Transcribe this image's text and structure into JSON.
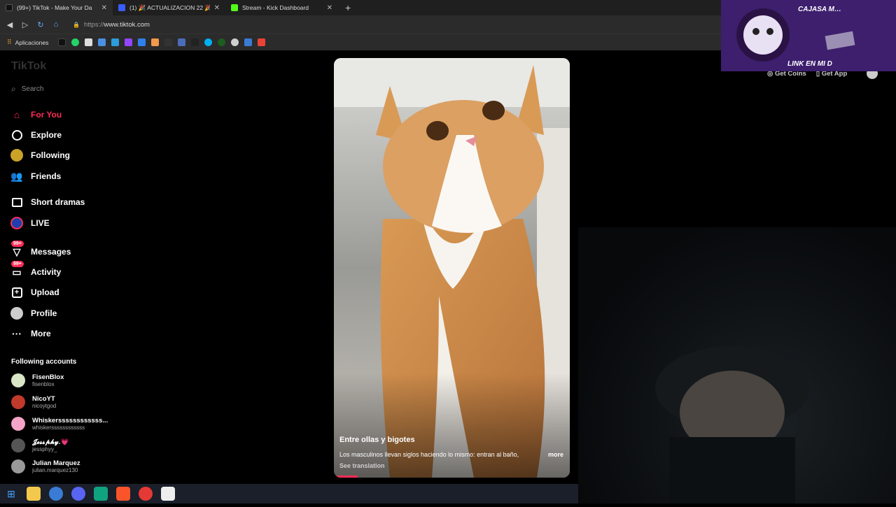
{
  "browser": {
    "tabs": [
      {
        "title": "(99+) TikTok - Make Your Da",
        "color": "#111111"
      },
      {
        "title": "(1) 🎉 ACTUALIZACION 22 🎉",
        "color": "#3b5cff"
      },
      {
        "title": "Stream - Kick Dashboard",
        "color": "#53fc18"
      }
    ],
    "new_tab": "+",
    "url_prefix": "https://",
    "url_host": "www.tiktok.com",
    "bookmarks_label": "Aplicaciones"
  },
  "sidebar": {
    "logo": "TikTok",
    "search_placeholder": "Search",
    "nav": [
      {
        "label": "For You",
        "icon": "home-icon",
        "active": true
      },
      {
        "label": "Explore",
        "icon": "compass-icon"
      },
      {
        "label": "Following",
        "icon": "following-avatar-icon"
      },
      {
        "label": "Friends",
        "icon": "friends-icon"
      },
      {
        "label": "Short dramas",
        "icon": "drama-icon"
      },
      {
        "label": "LIVE",
        "icon": "live-icon"
      },
      {
        "label": "Messages",
        "icon": "messages-icon",
        "badge": "99+"
      },
      {
        "label": "Activity",
        "icon": "activity-icon",
        "badge": "99+"
      },
      {
        "label": "Upload",
        "icon": "upload-icon"
      },
      {
        "label": "Profile",
        "icon": "profile-avatar-icon"
      },
      {
        "label": "More",
        "icon": "more-icon"
      }
    ],
    "following_title": "Following accounts",
    "accounts": [
      {
        "name": "FisenBlox",
        "handle": "fisenblox"
      },
      {
        "name": "NicoYT",
        "handle": "nicoytgod"
      },
      {
        "name": "Whiskerssssssssssss...",
        "handle": "whiskerssssssssssss"
      },
      {
        "name": "𝓙𝓮𝓼𝓼𝓹𝓱𝔂.💗",
        "handle": "jessphyy_"
      },
      {
        "name": "Julian Marquez",
        "handle": "julian.marquez130"
      }
    ]
  },
  "video": {
    "title": "Entre ollas y bigotes",
    "description": "Los masculinos llevan siglos haciendo lo mismo: entran al baño,",
    "more": "more",
    "translation": "See translation"
  },
  "top_right": {
    "coins": "Get Coins",
    "app": "Get App"
  },
  "stream_overlay": {
    "line1": "CAJASA M…",
    "line2": "LINK EN MI D"
  }
}
